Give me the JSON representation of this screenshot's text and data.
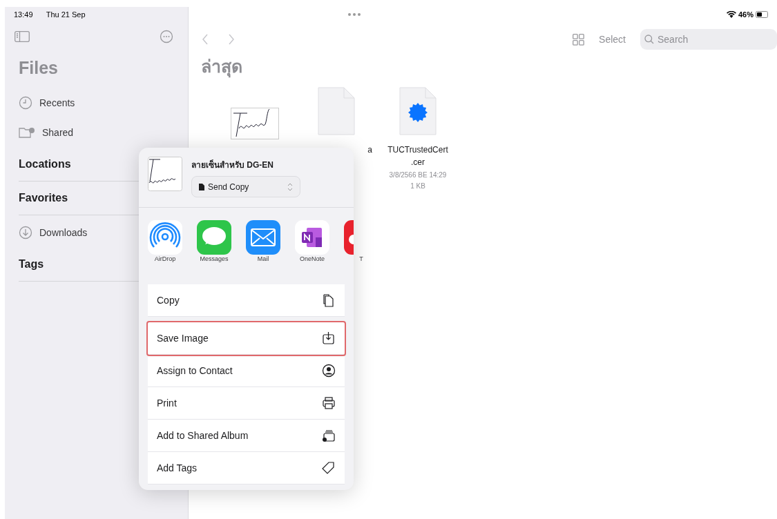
{
  "status_bar": {
    "time": "13:49",
    "date": "Thu 21 Sep",
    "battery": "46%"
  },
  "sidebar": {
    "title": "Files",
    "items": [
      {
        "label": "Recents"
      },
      {
        "label": "Shared"
      }
    ],
    "sections": [
      {
        "title": "Locations"
      },
      {
        "title": "Favorites",
        "items": [
          {
            "label": "Downloads"
          }
        ]
      },
      {
        "title": "Tags"
      }
    ]
  },
  "toolbar": {
    "select": "Select",
    "search_placeholder": "Search"
  },
  "main": {
    "title": "ล่าสุด",
    "files": [
      {
        "kind": "signature"
      },
      {
        "kind": "blank",
        "name": "a"
      },
      {
        "kind": "certificate",
        "name": "TUCTrustedCert .cer",
        "meta": [
          "3/8/2566 BE 14:29",
          "1 KB"
        ]
      }
    ]
  },
  "share_sheet": {
    "title": "ลายเซ็นสำหรับ DG-EN",
    "mode": "Send Copy",
    "apps": [
      {
        "kind": "airdrop",
        "label": "AirDrop"
      },
      {
        "kind": "messages",
        "label": "Messages"
      },
      {
        "kind": "mail",
        "label": "Mail"
      },
      {
        "kind": "onenote",
        "label": "OneNote"
      },
      {
        "kind": "other",
        "label": "T"
      }
    ],
    "actions": [
      {
        "label": "Copy",
        "highlighted": false
      },
      {
        "label": "Save Image",
        "highlighted": true
      },
      {
        "label": "Assign to Contact",
        "highlighted": false
      },
      {
        "label": "Print",
        "highlighted": false
      },
      {
        "label": "Add to Shared Album",
        "highlighted": false
      },
      {
        "label": "Add Tags",
        "highlighted": false
      }
    ]
  }
}
